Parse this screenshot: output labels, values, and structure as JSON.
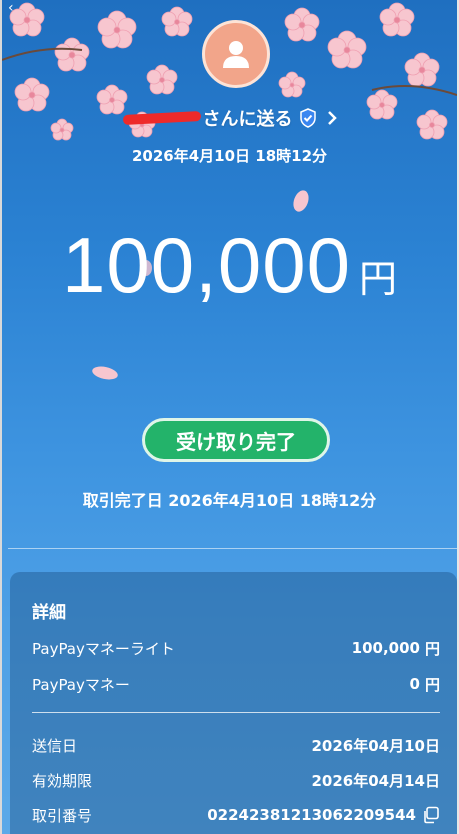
{
  "header": {
    "recipient_suffix": "さんに送る",
    "sent_datetime": "2026年4月10日 18時12分"
  },
  "amount": {
    "value": "100,000",
    "unit": "円"
  },
  "status": {
    "label": "受け取り完了",
    "completed_label": "取引完了日 2026年4月10日 18時12分"
  },
  "details": {
    "title": "詳細",
    "breakdown": [
      {
        "label": "PayPayマネーライト",
        "value": "100,000",
        "unit": "円"
      },
      {
        "label": "PayPayマネー",
        "value": "0",
        "unit": "円"
      }
    ],
    "info": [
      {
        "label": "送信日",
        "value": "2026年04月10日"
      },
      {
        "label": "有効期限",
        "value": "2026年04月14日"
      },
      {
        "label": "取引番号",
        "value": "02242381213062209544"
      }
    ]
  },
  "colors": {
    "background_top": "#1f6fc0",
    "background_bottom": "#5ba9e8",
    "status_green": "#23b36a",
    "avatar": "#f2a58a",
    "redaction": "#ee2a2a"
  },
  "icons": [
    "back-icon",
    "avatar-person-icon",
    "verified-shield-icon",
    "chevron-right-icon",
    "copy-icon"
  ]
}
